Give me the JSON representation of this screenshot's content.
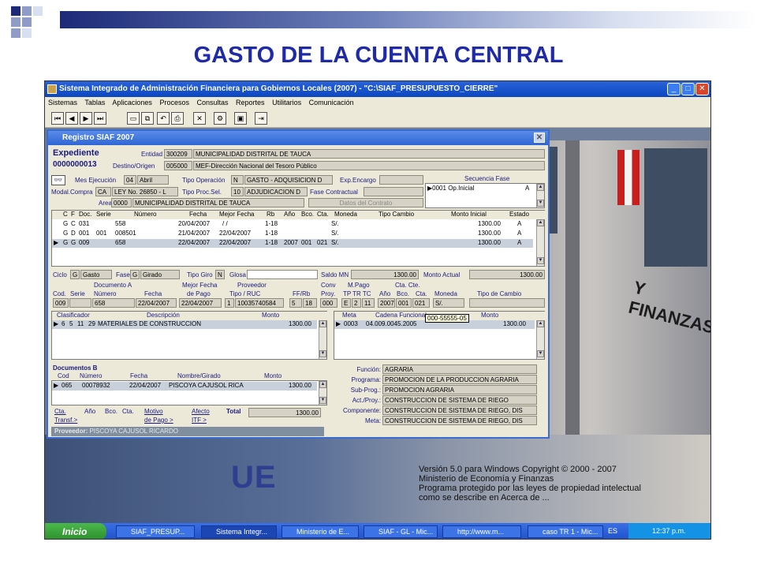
{
  "slide": {
    "title": "GASTO DE LA CUENTA CENTRAL"
  },
  "colors": {
    "title": "#1f2aa8",
    "accent_dark": "#1c2a78",
    "accent_light": "#8f9cc8"
  },
  "app": {
    "title": "Sistema Integrado de Administración Financiera para Gobiernos Locales (2007) - \"C:\\SIAF_PRESUPUESTO_CIERRE\"",
    "menu": [
      "Sistemas",
      "Tablas",
      "Aplicaciones",
      "Procesos",
      "Consultas",
      "Reportes",
      "Utilitarios",
      "Comunicación"
    ]
  },
  "dialog": {
    "title": "Registro SIAF 2007",
    "expediente_label": "Expediente",
    "expediente_value": "0000000013",
    "entidad_label": "Entidad",
    "entidad_code": "300209",
    "entidad_name": "MUNICIPALIDAD DISTRITAL DE TAUCA",
    "destino_label": "Destino/Origen",
    "destino_code": "005000",
    "destino_name": "MEF-Dirección Nacional del Tesoro Público",
    "mes_label": "Mes Ejecución",
    "mes_num": "04",
    "mes_name": "Abril",
    "tipo_op_label": "Tipo Operación",
    "tipo_op_code": "N",
    "tipo_op_name": "GASTO - ADQUISICION D",
    "exp_encargo_label": "Exp.Encargo",
    "modal_label": "Modal.Compra",
    "modal_code": "CA",
    "modal_name": "LEY No. 26850 - L",
    "tipo_proc_label": "Tipo Proc.Sel.",
    "tipo_proc_code": "10",
    "tipo_proc_name": "ADJUDICACION D",
    "fase_contractual_label": "Fase Contractual",
    "area_label": "Area",
    "area_code": "0000",
    "area_name": "MUNICIPALIDAD DISTRITAL DE TAUCA",
    "datos_contrato": "Datos del Contrato",
    "secuencia_label": "Secuencia Fase",
    "secuencia_row": {
      "code": "0001",
      "name": "Op.Inicial",
      "estado": "A"
    },
    "main_headers": [
      "C",
      "F",
      "Doc.",
      "Serie",
      "Número",
      "Fecha",
      "Mejor Fecha",
      "Rb",
      "Año",
      "Bco.",
      "Cta.",
      "Moneda",
      "Tipo Cambio",
      "Monto Inicial",
      "Estado"
    ],
    "main_rows": [
      [
        "G",
        "C",
        "031",
        "",
        "558",
        "20/04/2007",
        " /  /",
        "1-18",
        "",
        "",
        "",
        "S/.",
        "",
        "1300.00",
        "A"
      ],
      [
        "G",
        "D",
        "001",
        "001",
        "008501",
        "21/04/2007",
        "22/04/2007",
        "1-18",
        "",
        "",
        "",
        "S/.",
        "",
        "1300.00",
        "A"
      ],
      [
        "G",
        "G",
        "009",
        "",
        "658",
        "22/04/2007",
        "22/04/2007",
        "1-18",
        "2007",
        "001",
        "021",
        "S/.",
        "",
        "1300.00",
        "A"
      ]
    ],
    "ciclo_label": "Ciclo",
    "ciclo_code": "G",
    "ciclo_name": "Gasto",
    "fase_label": "Fase",
    "fase_code": "G",
    "fase_name": "Girado",
    "tipo_giro_label": "Tipo Giro",
    "tipo_giro_code": "N",
    "glosa_label": "Glosa",
    "saldo_label": "Saldo MN",
    "saldo_value": "1300.00",
    "monto_actual_label": "Monto Actual",
    "monto_actual_value": "1300.00",
    "doc_a_label": "Documento A",
    "doc_a_headers": [
      "Cod.",
      "Serie",
      "Número",
      "Fecha"
    ],
    "doc_a_values": [
      "009",
      "",
      "658",
      "22/04/2007"
    ],
    "mejor_fecha_label": "Mejor Fecha",
    "de_pago_label": "de Pago",
    "mejor_fecha_value": "22/04/2007",
    "proveedor_label": "Proveedor",
    "tipo_ruc_label": "Tipo / RUC",
    "tipo_ruc_value": "1",
    "ruc_value": "10035740584",
    "ffrb_label": "FF/Rb",
    "ff_value": "5",
    "rb_value": "18",
    "conv_label": "Conv",
    "proy_label": "Proy.",
    "conv_value": "000",
    "mpago_label": "M.Pago",
    "tptr_label": "TP TR TC",
    "tptr_values": [
      "E",
      "2",
      "11"
    ],
    "cta_cte_label": "Cta. Cte.",
    "ano_bco_labels": [
      "Año",
      "Bco.",
      "Cta."
    ],
    "ano_bco_values": [
      "2007",
      "001",
      "021"
    ],
    "moneda_label": "Moneda",
    "moneda_value": "S/.",
    "tipo_cambio_label": "Tipo de Cambio",
    "clasif_headers": [
      "Clasificador",
      "Descripción",
      "Monto"
    ],
    "clasif_row": {
      "codes": [
        "6",
        "5",
        "11",
        "29"
      ],
      "desc": "MATERIALES DE CONSTRUCCION",
      "monto": "1300.00"
    },
    "meta_headers": [
      "Meta",
      "Cadena Funcional",
      "Monto"
    ],
    "meta_row": {
      "meta": "0003",
      "cadena": "04.009.0045.2005",
      "monto": "1300.00"
    },
    "tooltip": "000-55555-05",
    "doc_b_label": "Documentos B",
    "doc_b_headers": [
      "Cod",
      "Número",
      "Fecha",
      "Nombre/Girado",
      "Monto"
    ],
    "doc_b_row": [
      "065",
      "00078932",
      "22/04/2007",
      "PISCOYA CAJUSOL RICA",
      "1300.00"
    ],
    "footer_labels": [
      "Cta.",
      "Año",
      "Bco.",
      "Cta.",
      "Motivo",
      "Afecto",
      "Total"
    ],
    "transf_label": "Transf.>",
    "depago_link": "de Pago >",
    "itf_label": "ITF >",
    "total_value": "1300.00",
    "funcion_labels": [
      "Función:",
      "Programa:",
      "Sub-Prog.:",
      "Act./Proy.:",
      "Componente:",
      "Meta:"
    ],
    "funcion_values": [
      "AGRARIA",
      "PROMOCION DE LA PRODUCCION AGRARIA",
      "PROMOCION AGRARIA",
      "CONSTRUCCION DE SISTEMA DE RIEGO",
      "CONSTRUCCION DE SISTEMA DE RIEGO, DIS",
      "CONSTRUCCION DE SISTEMA DE RIEGO, DIS"
    ],
    "proveedor_bar_label": "Proveedor:",
    "proveedor_bar_value": "PISCOYA CAJUSOL RICARDO"
  },
  "background": {
    "building_text": "Y FINANZAS",
    "ue_text": "UE",
    "version_lines": [
      "Versión 5.0 para Windows Copyright © 2000 - 2007",
      "Ministerio de Economía y Finanzas",
      "Programa protegido por las leyes de propiedad intelectual",
      "como se describe en Acerca de ..."
    ]
  },
  "taskbar": {
    "start": "Inicio",
    "tasks": [
      "SIAF_PRESUP...",
      "Sistema Integr...",
      "Ministerio de E...",
      "SIAF - GL - Mic...",
      "http://www.m...",
      "caso TR 1 - Mic..."
    ],
    "lang": "ES",
    "time": "12:37 p.m."
  }
}
